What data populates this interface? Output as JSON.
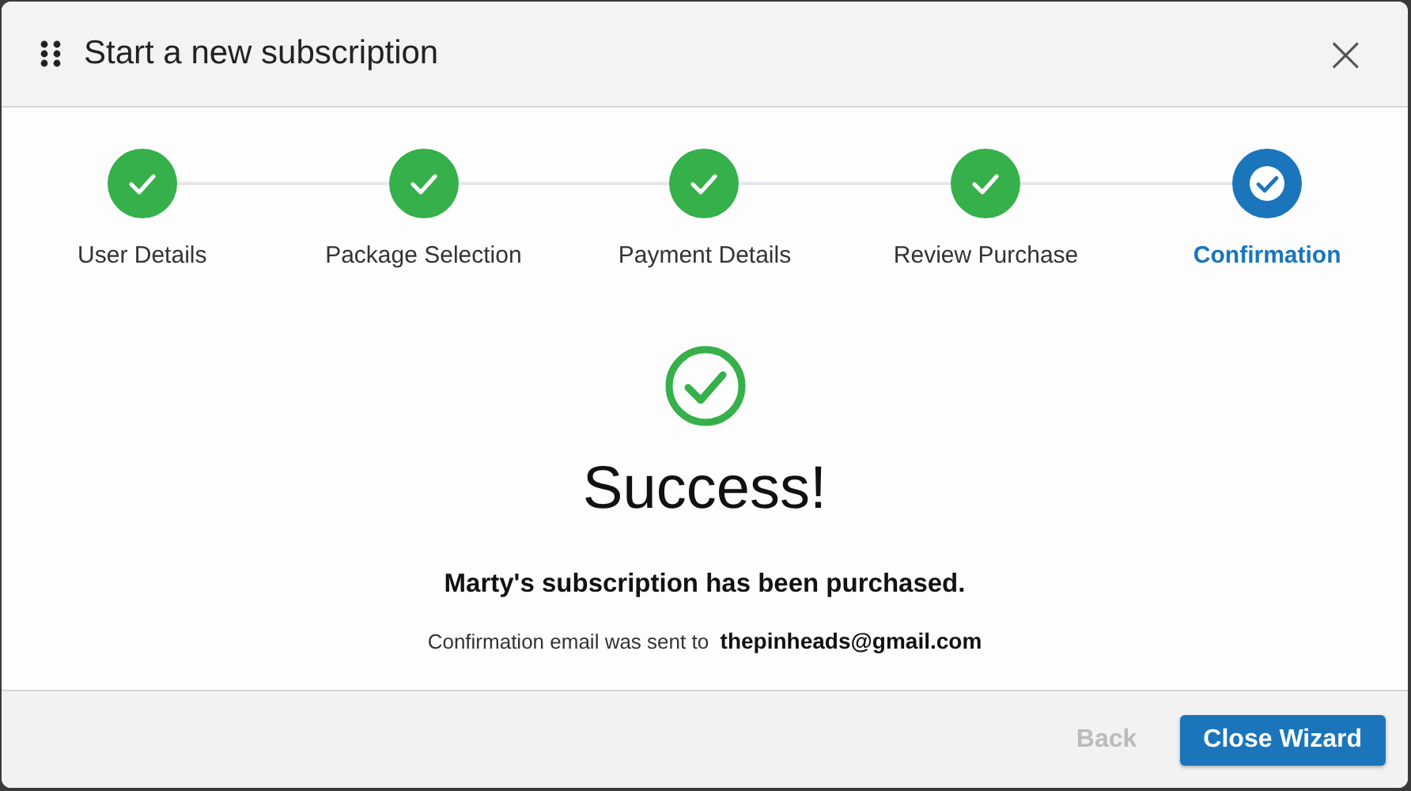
{
  "dialog": {
    "title": "Start a new subscription",
    "close": "×"
  },
  "steps": [
    {
      "label": "User Details",
      "completed": true,
      "selected": false
    },
    {
      "label": "Package Selection",
      "completed": true,
      "selected": false
    },
    {
      "label": "Payment Details",
      "completed": true,
      "selected": false
    },
    {
      "label": "Review Purchase",
      "completed": true,
      "selected": false
    },
    {
      "label": "Confirmation",
      "completed": true,
      "selected": true
    }
  ],
  "result": {
    "heading": "Success!",
    "message": "Marty's subscription has been purchased.",
    "email_note": "Confirmation email was sent to  **thepinheads@gmail.com**"
  },
  "buttons": [
    {
      "label": "Back",
      "kind": "secondary",
      "disabled": true
    },
    {
      "label": "Close Wizard",
      "kind": "primary",
      "disabled": false
    }
  ]
}
